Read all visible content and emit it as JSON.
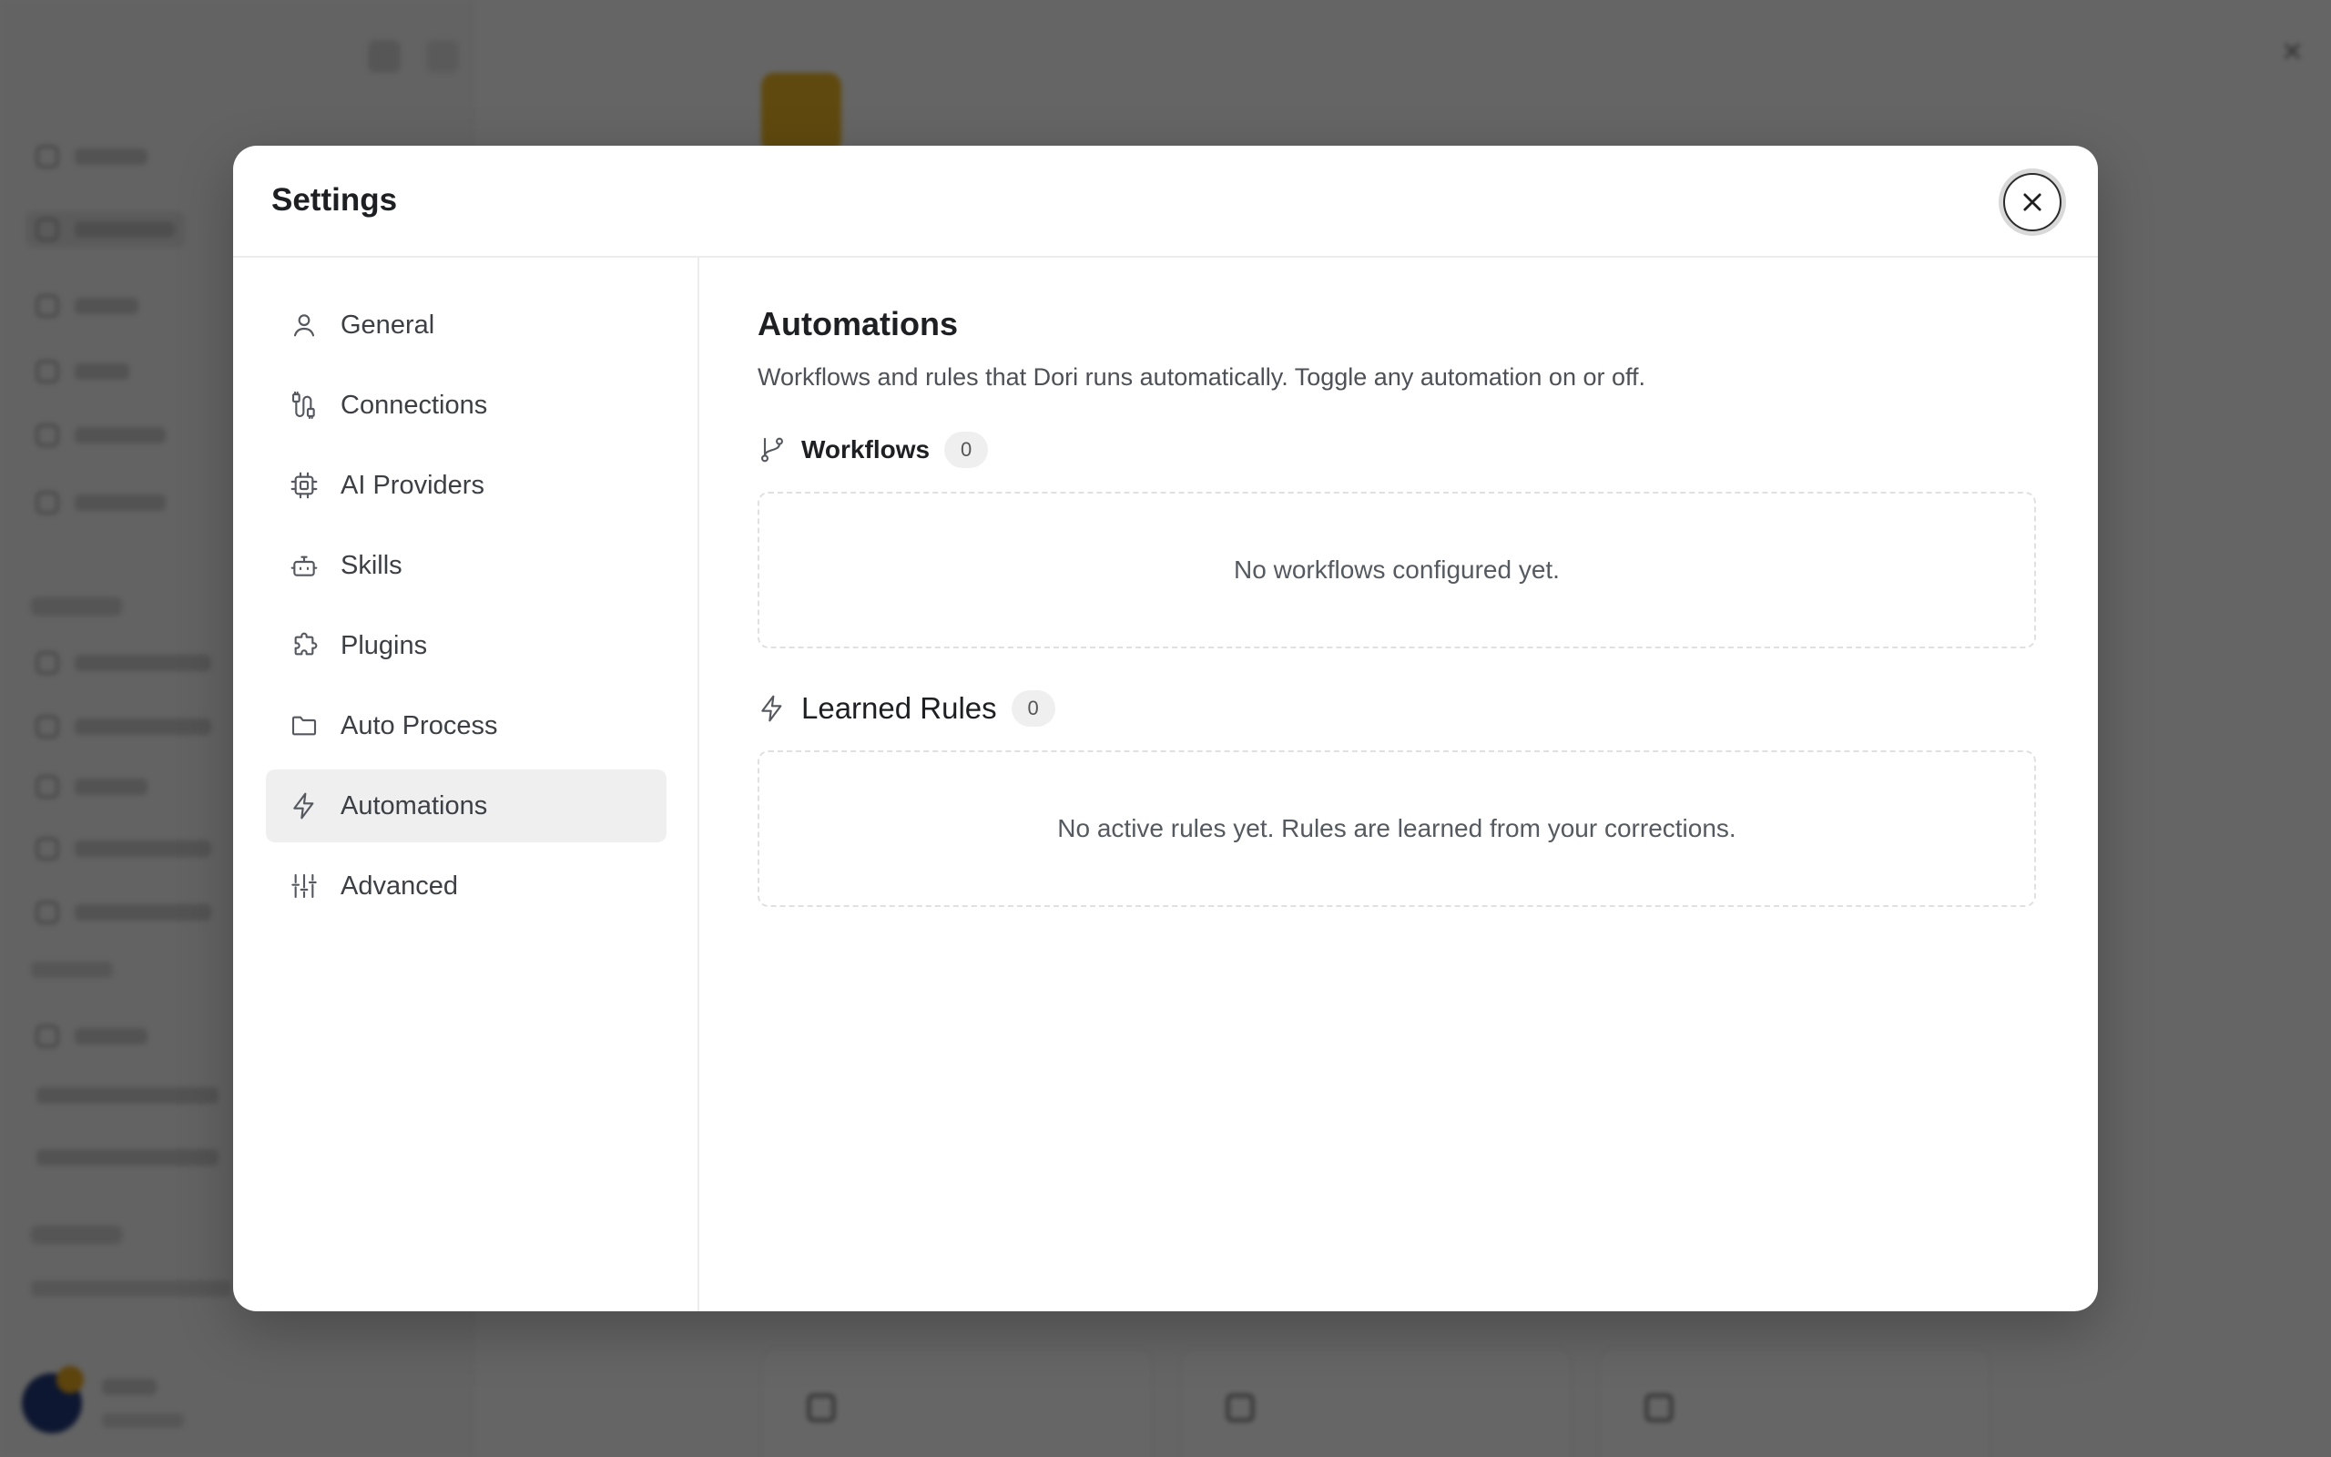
{
  "modal": {
    "title": "Settings",
    "close_icon": "close-icon"
  },
  "nav": {
    "active": "Automations",
    "items": [
      {
        "label": "General",
        "icon": "user-icon"
      },
      {
        "label": "Connections",
        "icon": "cable-icon"
      },
      {
        "label": "AI Providers",
        "icon": "cpu-icon"
      },
      {
        "label": "Skills",
        "icon": "bot-icon"
      },
      {
        "label": "Plugins",
        "icon": "puzzle-icon"
      },
      {
        "label": "Auto Process",
        "icon": "folder-icon"
      },
      {
        "label": "Automations",
        "icon": "lightning-icon"
      },
      {
        "label": "Advanced",
        "icon": "sliders-icon"
      }
    ]
  },
  "content": {
    "title": "Automations",
    "description": "Workflows and rules that Dori runs automatically. Toggle any automation on or off.",
    "workflows": {
      "title": "Workflows",
      "count": "0",
      "icon": "git-branch-icon",
      "empty_text": "No workflows configured yet."
    },
    "learned_rules": {
      "title": "Learned Rules",
      "count": "0",
      "icon": "lightning-icon",
      "empty_text": "No active rules yet. Rules are learned from your corrections."
    }
  },
  "colors": {
    "overlay": "#000000",
    "active_nav_bg": "#efeff0",
    "brand_logo": "#f0b726"
  }
}
